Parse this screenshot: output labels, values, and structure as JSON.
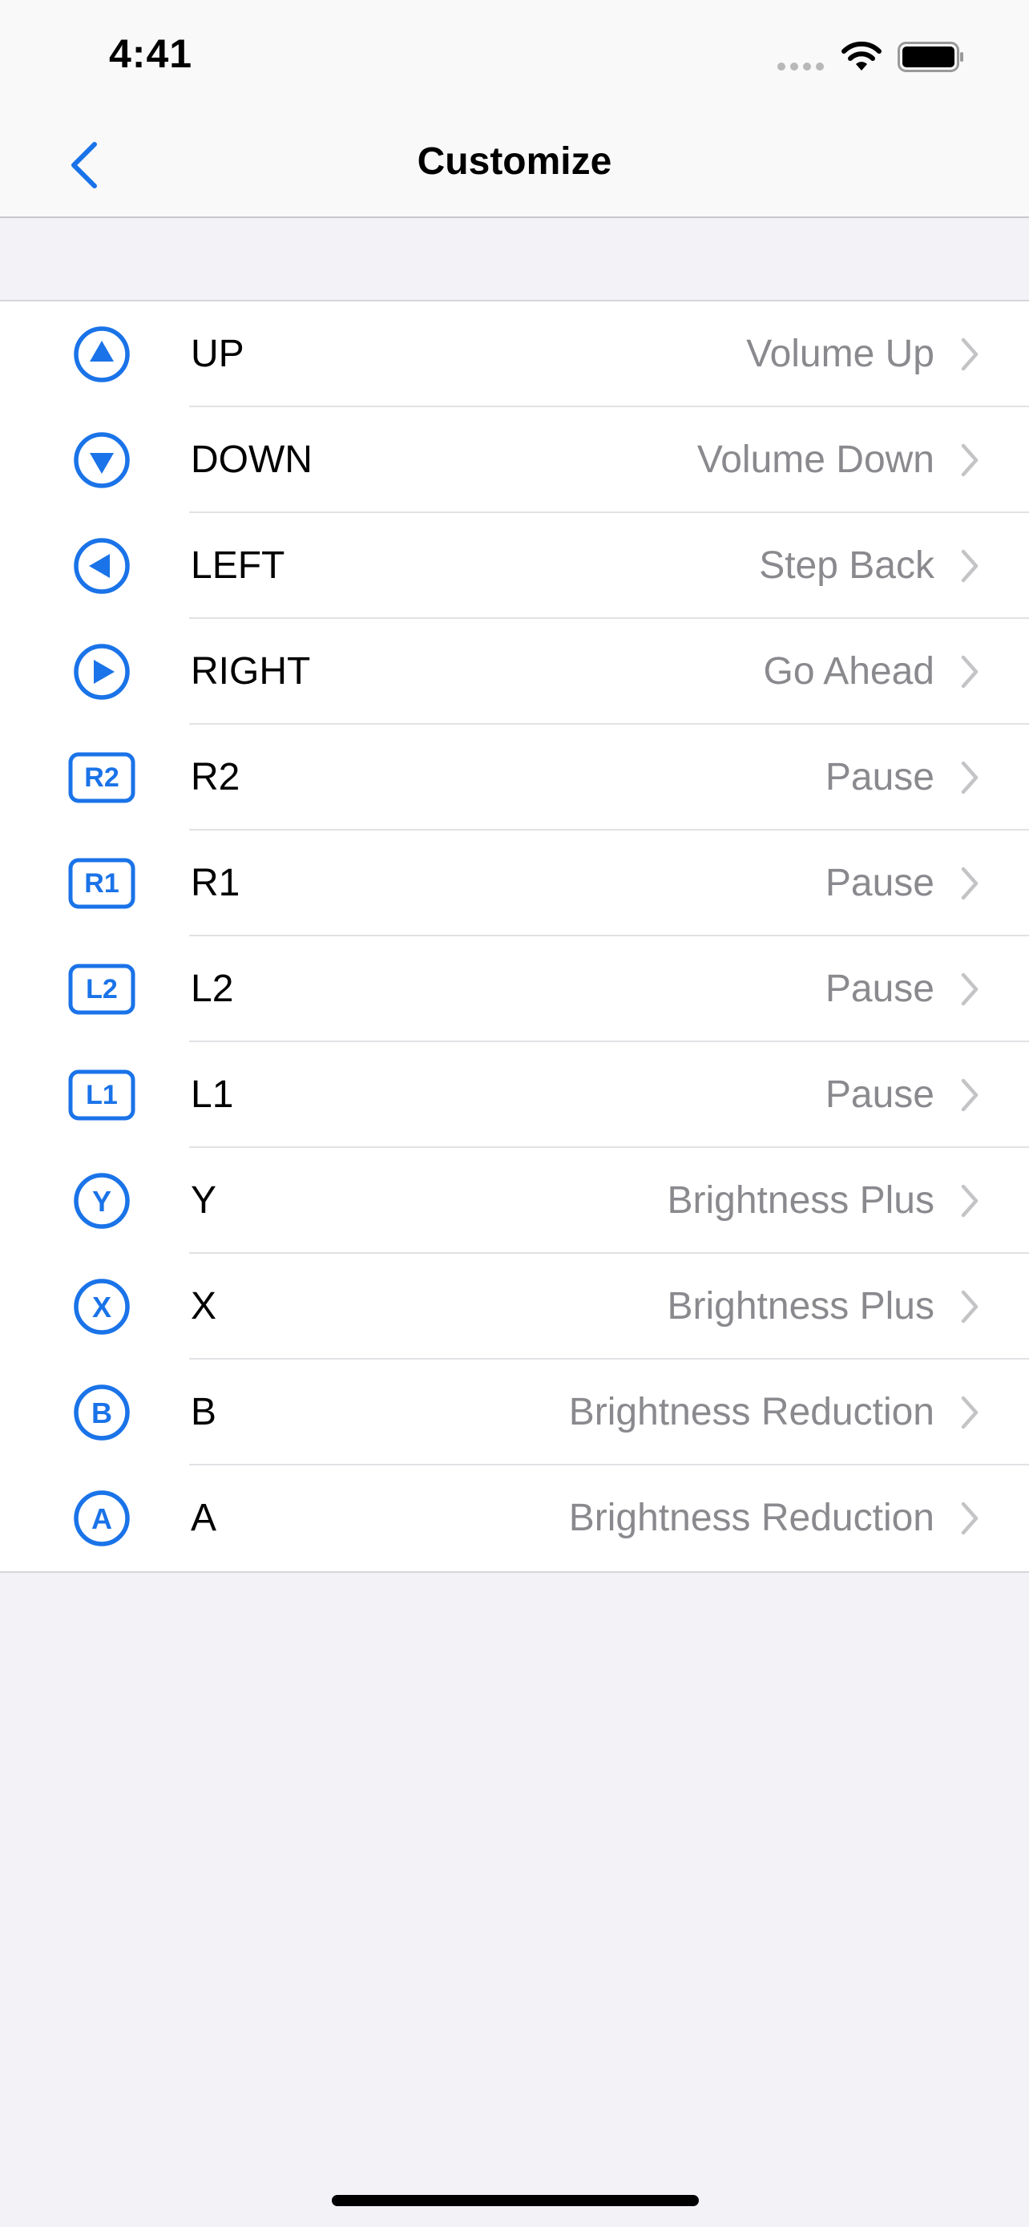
{
  "status_bar": {
    "time": "4:41"
  },
  "nav": {
    "title": "Customize",
    "back_icon": "chevron-left-icon"
  },
  "colors": {
    "accent": "#1a73e8",
    "value_text": "#8a8a8e",
    "background": "#f2f2f7"
  },
  "rows": [
    {
      "label": "UP",
      "value": "Volume Up",
      "icon": "triangle-up-icon",
      "icon_text": ""
    },
    {
      "label": "DOWN",
      "value": "Volume Down",
      "icon": "triangle-down-icon",
      "icon_text": ""
    },
    {
      "label": "LEFT",
      "value": "Step Back",
      "icon": "triangle-left-icon",
      "icon_text": ""
    },
    {
      "label": "RIGHT",
      "value": "Go Ahead",
      "icon": "triangle-right-icon",
      "icon_text": ""
    },
    {
      "label": "R2",
      "value": "Pause",
      "icon": "r2-button-icon",
      "icon_text": "R2"
    },
    {
      "label": "R1",
      "value": "Pause",
      "icon": "r1-button-icon",
      "icon_text": "R1"
    },
    {
      "label": "L2",
      "value": "Pause",
      "icon": "l2-button-icon",
      "icon_text": "L2"
    },
    {
      "label": "L1",
      "value": "Pause",
      "icon": "l1-button-icon",
      "icon_text": "L1"
    },
    {
      "label": "Y",
      "value": "Brightness Plus",
      "icon": "y-button-icon",
      "icon_text": "Y"
    },
    {
      "label": "X",
      "value": "Brightness Plus",
      "icon": "x-button-icon",
      "icon_text": "X"
    },
    {
      "label": "B",
      "value": "Brightness Reduction",
      "icon": "b-button-icon",
      "icon_text": "B"
    },
    {
      "label": "A",
      "value": "Brightness Reduction",
      "icon": "a-button-icon",
      "icon_text": "A"
    }
  ]
}
